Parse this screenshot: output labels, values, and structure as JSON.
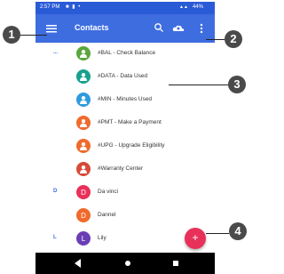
{
  "status_bar": {
    "time": "2:57 PM",
    "battery": "44%"
  },
  "app_bar": {
    "title": "Contacts"
  },
  "contacts": [
    {
      "section": "...",
      "name": "#BAL - Check Balance",
      "avatar_color": "#5aa63c",
      "avatar": "person"
    },
    {
      "section": "",
      "name": "#DATA - Data Used",
      "avatar_color": "#16a08e",
      "avatar": "person"
    },
    {
      "section": "",
      "name": "#MIN - Minutes Used",
      "avatar_color": "#2d9be0",
      "avatar": "person"
    },
    {
      "section": "",
      "name": "#PMT - Make a Payment",
      "avatar_color": "#ef6a2c",
      "avatar": "person"
    },
    {
      "section": "",
      "name": "#UPG - Upgrade Eligibility",
      "avatar_color": "#ef6a2c",
      "avatar": "person"
    },
    {
      "section": "",
      "name": "#Warranty Center",
      "avatar_color": "#d64a3a",
      "avatar": "person"
    },
    {
      "section": "D",
      "name": "Da vinci",
      "avatar_color": "#e8315a",
      "avatar": "D"
    },
    {
      "section": "",
      "name": "Dannel",
      "avatar_color": "#ef6a2c",
      "avatar": "D"
    },
    {
      "section": "L",
      "name": "Lily",
      "avatar_color": "#6a3fb5",
      "avatar": "L"
    }
  ],
  "fab": {
    "label": "+",
    "color": "#e8315a"
  },
  "callouts": [
    "1",
    "2",
    "3",
    "4"
  ],
  "colors": {
    "status_bar": "#2a5bd7",
    "app_bar": "#3e6de0",
    "callout": "#4a4a4a"
  },
  "icons": {
    "menu": "hamburger-menu-icon",
    "search": "search-icon",
    "account": "cloud-account-icon",
    "more": "more-vertical-icon",
    "back": "back-triangle-icon",
    "home": "home-circle-icon",
    "recent": "recent-apps-square-icon"
  }
}
